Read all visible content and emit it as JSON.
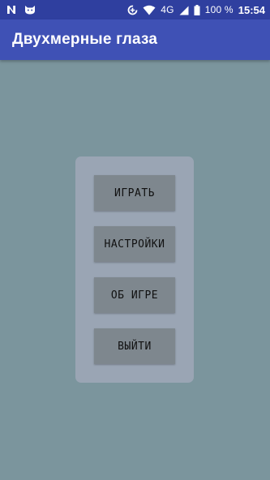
{
  "status_bar": {
    "network_type": "4G",
    "battery_percent": "100 %",
    "time": "15:54",
    "icons": [
      "notification-n-icon",
      "cat-icon",
      "data-saver-icon",
      "wifi-icon",
      "signal-icon",
      "battery-icon"
    ]
  },
  "app_bar": {
    "title": "Двухмерные глаза"
  },
  "menu": {
    "play_label": "ИГРАТЬ",
    "settings_label": "НАСТРОЙКИ",
    "about_label": "ОБ ИГРЕ",
    "exit_label": "ВЫЙТИ"
  },
  "colors": {
    "status_bar": "#2f3f9f",
    "app_bar": "#3f51b5",
    "background": "#7b959d",
    "panel": "#9aa5b4",
    "button": "#7e878e"
  }
}
